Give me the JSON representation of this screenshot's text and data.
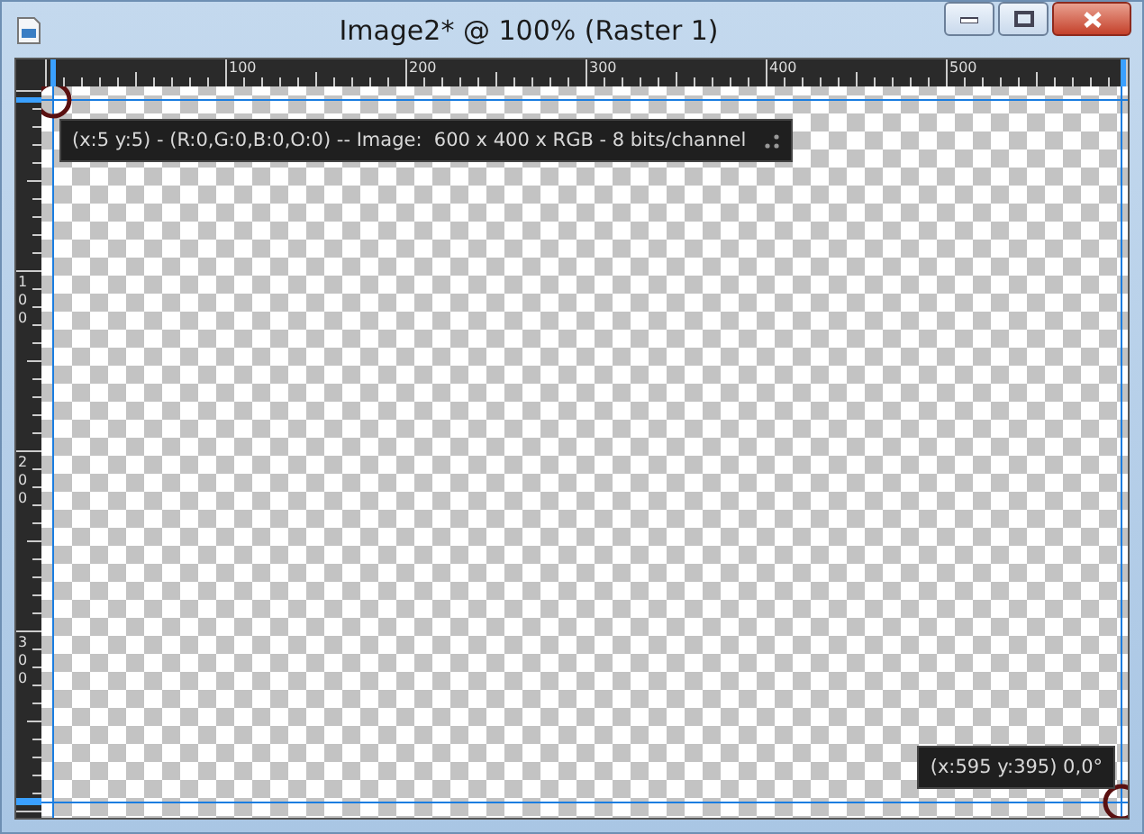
{
  "window": {
    "title": "Image2* @ 100% (Raster 1)"
  },
  "rulers": {
    "top_labels": [
      "100",
      "200",
      "300",
      "400",
      "500"
    ],
    "left_labels": [
      "100",
      "200",
      "300"
    ]
  },
  "tooltips": [
    {
      "kind": "info",
      "text": "(x:5 y:5) - (R:0,G:0,B:0,O:0) -- Image:  600 x 400 x RGB - 8 bits/channel"
    },
    {
      "kind": "position",
      "text": "(x:595 y:395) 0,0°"
    }
  ]
}
